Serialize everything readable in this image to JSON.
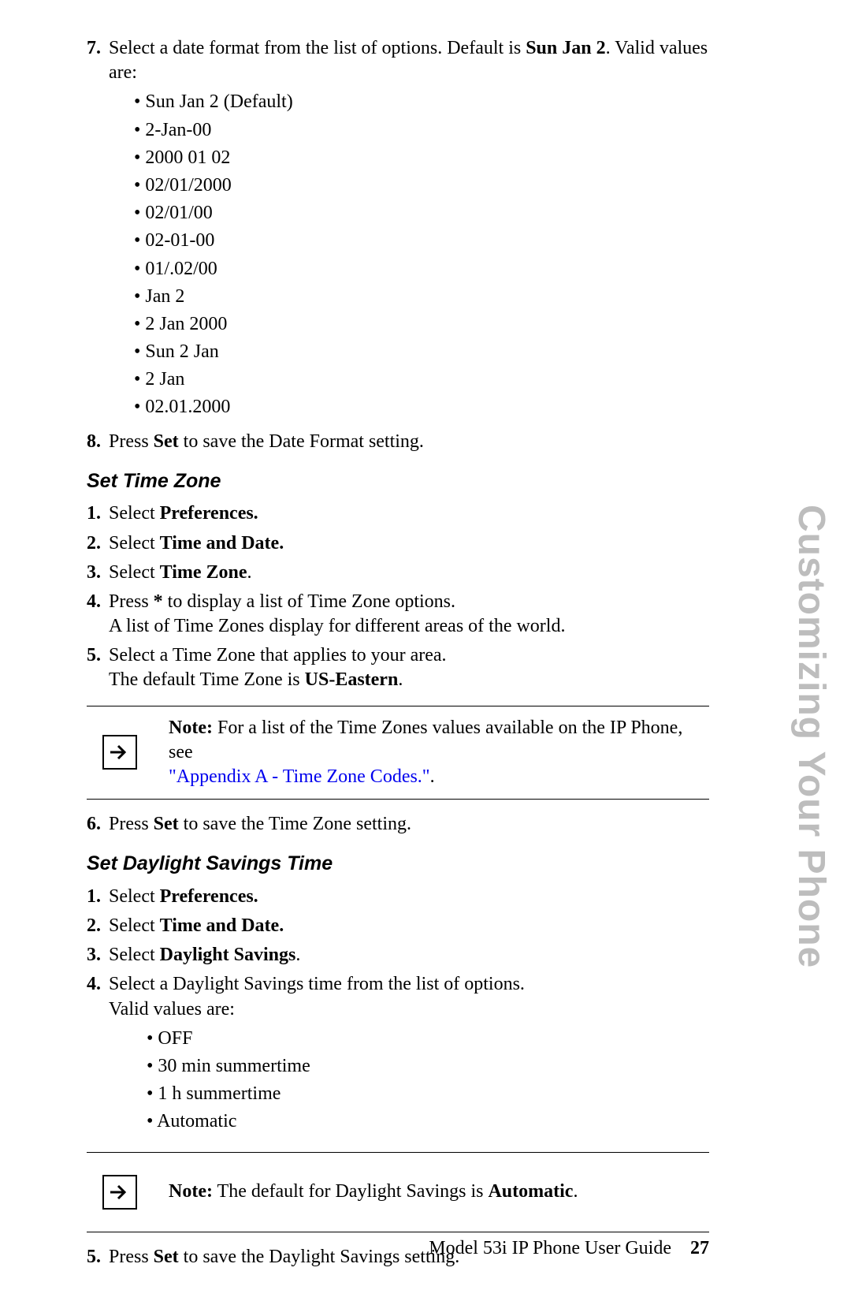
{
  "side_title": "Customizing Your Phone",
  "step7": {
    "num": "7.",
    "pre": "Select a date format from the list of options. Default is ",
    "bold": "Sun Jan 2",
    "post": ". Valid values are:",
    "items": [
      "Sun Jan 2 (Default)",
      "2-Jan-00",
      "2000 01 02",
      "02/01/2000",
      "02/01/00",
      "02-01-00",
      "01/.02/00",
      "Jan 2",
      "2 Jan 2000",
      "Sun 2 Jan",
      "2 Jan",
      "02.01.2000"
    ]
  },
  "step8": {
    "num": "8.",
    "pre": "Press ",
    "bold": "Set",
    "post": " to save the Date Format setting."
  },
  "tz_heading": "Set Time Zone",
  "tz": {
    "s1": {
      "num": "1.",
      "pre": "Select ",
      "bold": "Preferences."
    },
    "s2": {
      "num": "2.",
      "pre": "Select ",
      "bold": "Time and Date."
    },
    "s3": {
      "num": "3.",
      "pre": "Select ",
      "bold": "Time Zone",
      "post": "."
    },
    "s4": {
      "num": "4.",
      "pre": "Press ",
      "bold": "*",
      "post": " to display a list of Time Zone options.",
      "line2": "A list of Time Zones display for different areas of the world."
    },
    "s5": {
      "num": "5.",
      "line1": "Select a Time Zone that applies to your area.",
      "pre2": "The default Time Zone is ",
      "bold2": "US-Eastern",
      "post2": "."
    },
    "s6": {
      "num": "6.",
      "pre": "Press ",
      "bold": "Set",
      "post": " to save the Time Zone setting."
    }
  },
  "tz_note": {
    "bold": "Note:",
    "text": " For a list of the Time Zones values available on the IP Phone, see",
    "link": "\"Appendix A - Time Zone Codes.\"",
    "tail": "."
  },
  "dst_heading": "Set Daylight Savings Time",
  "dst": {
    "s1": {
      "num": "1.",
      "pre": "Select ",
      "bold": "Preferences."
    },
    "s2": {
      "num": "2.",
      "pre": "Select ",
      "bold": "Time and Date."
    },
    "s3": {
      "num": "3.",
      "pre": "Select ",
      "bold": "Daylight Savings",
      "post": "."
    },
    "s4": {
      "num": "4.",
      "line1": "Select a Daylight Savings time from the list of options.",
      "line2": "Valid values are:",
      "items": [
        "OFF",
        "30 min summertime",
        "1 h summertime",
        "Automatic"
      ]
    },
    "s5": {
      "num": "5.",
      "pre": "Press ",
      "bold": "Set",
      "post": " to save the Daylight Savings setting."
    }
  },
  "dst_note": {
    "bold": "Note:",
    "pre": " The default for Daylight Savings is ",
    "bold2": "Automatic",
    "post": "."
  },
  "footer": {
    "title": "Model 53i IP Phone User Guide",
    "page": "27"
  }
}
